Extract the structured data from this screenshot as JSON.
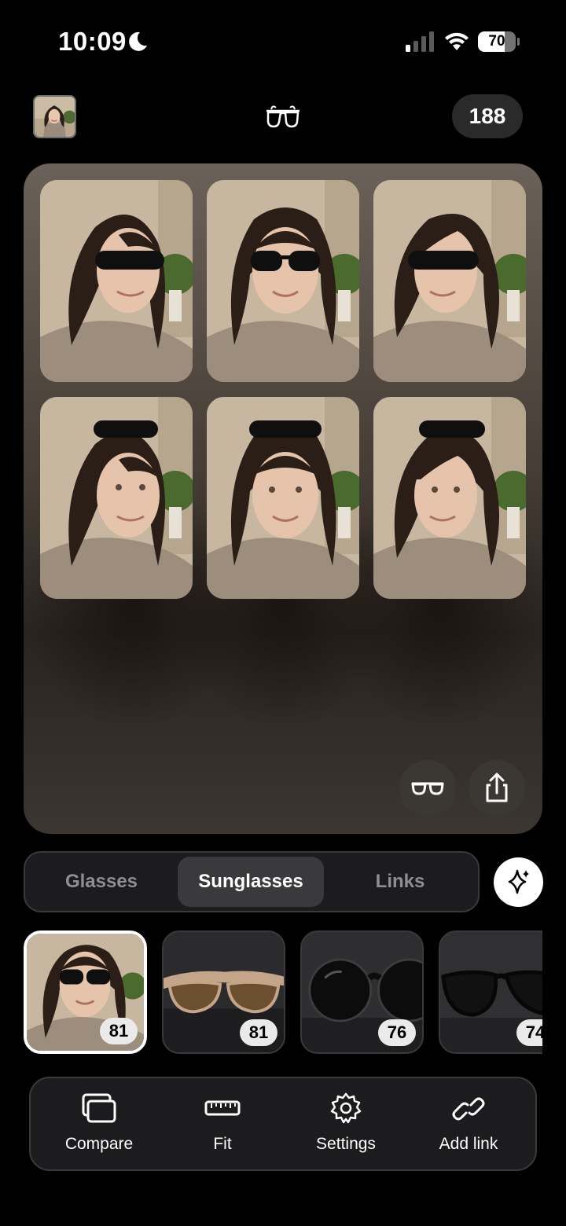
{
  "status_bar": {
    "time": "10:09",
    "battery_level": "70",
    "battery_fraction": 0.7,
    "icons": [
      "moon-icon",
      "cellular-signal-icon",
      "wifi-icon",
      "battery-icon"
    ]
  },
  "header": {
    "credits": "188",
    "logo_icon": "glasses-logo-icon",
    "avatar_icon": "profile-photo"
  },
  "gallery": {
    "photos": [
      {
        "pose": "three-quarter left",
        "glasses": "sunglasses on eyes"
      },
      {
        "pose": "front",
        "glasses": "sunglasses on eyes"
      },
      {
        "pose": "three-quarter right",
        "glasses": "sunglasses on eyes"
      },
      {
        "pose": "three-quarter left",
        "glasses": "sunglasses on head"
      },
      {
        "pose": "front",
        "glasses": "sunglasses on head"
      },
      {
        "pose": "three-quarter right",
        "glasses": "sunglasses on head"
      }
    ],
    "actions": [
      "glasses-toggle-icon",
      "share-icon"
    ]
  },
  "tabs": {
    "items": [
      "Glasses",
      "Sunglasses",
      "Links"
    ],
    "active": "Sunglasses",
    "magic_icon": "sparkles-icon"
  },
  "thumbnails": [
    {
      "kind": "portrait",
      "score": "81",
      "selected": true
    },
    {
      "kind": "tan wraparound sunglasses",
      "score": "81",
      "selected": false
    },
    {
      "kind": "black round sunglasses",
      "score": "76",
      "selected": false
    },
    {
      "kind": "black oversized sunglasses",
      "score": "74",
      "selected": false
    }
  ],
  "toolbar": {
    "compare": "Compare",
    "fit": "Fit",
    "settings": "Settings",
    "add_link": "Add link"
  },
  "colors": {
    "background": "#000000",
    "panel": "#1c1c1e",
    "active_segment": "#3a3a3c",
    "inactive_text": "#8e8e93",
    "score_badge": "#eaeaea"
  }
}
